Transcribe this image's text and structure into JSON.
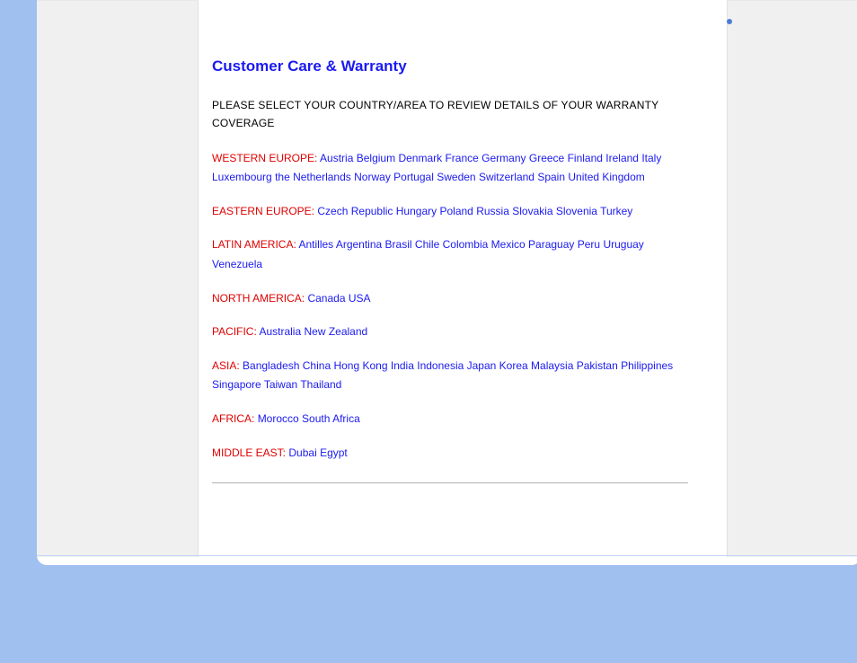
{
  "title": "Customer Care & Warranty",
  "instruction": "PLEASE SELECT YOUR COUNTRY/AREA TO REVIEW DETAILS OF YOUR WARRANTY COVERAGE",
  "regions": [
    {
      "label": "WESTERN EUROPE:",
      "countries": [
        "Austria",
        "Belgium",
        "Denmark",
        "France",
        "Germany",
        "Greece",
        "Finland",
        "Ireland",
        "Italy",
        "Luxembourg",
        "the Netherlands",
        "Norway",
        "Portugal",
        "Sweden",
        "Switzerland",
        "Spain",
        "United Kingdom"
      ]
    },
    {
      "label": "EASTERN EUROPE:",
      "countries": [
        "Czech Republic",
        "Hungary",
        "Poland",
        "Russia",
        "Slovakia",
        "Slovenia",
        "Turkey"
      ]
    },
    {
      "label": "LATIN AMERICA:",
      "countries": [
        "Antilles",
        "Argentina",
        "Brasil",
        "Chile",
        "Colombia",
        "Mexico",
        "Paraguay",
        "Peru",
        "Uruguay",
        "Venezuela"
      ]
    },
    {
      "label": "NORTH AMERICA:",
      "countries": [
        "Canada",
        "USA"
      ]
    },
    {
      "label": "PACIFIC:",
      "countries": [
        "Australia",
        "New Zealand"
      ]
    },
    {
      "label": "ASIA:",
      "countries": [
        "Bangladesh",
        "China",
        "Hong Kong",
        "India",
        "Indonesia",
        "Japan",
        "Korea",
        "Malaysia",
        "Pakistan",
        "Philippines",
        "Singapore",
        "Taiwan",
        "Thailand"
      ]
    },
    {
      "label": "AFRICA:",
      "countries": [
        "Morocco",
        "South Africa"
      ]
    },
    {
      "label": "MIDDLE EAST:",
      "countries": [
        "Dubai",
        "Egypt"
      ]
    }
  ]
}
